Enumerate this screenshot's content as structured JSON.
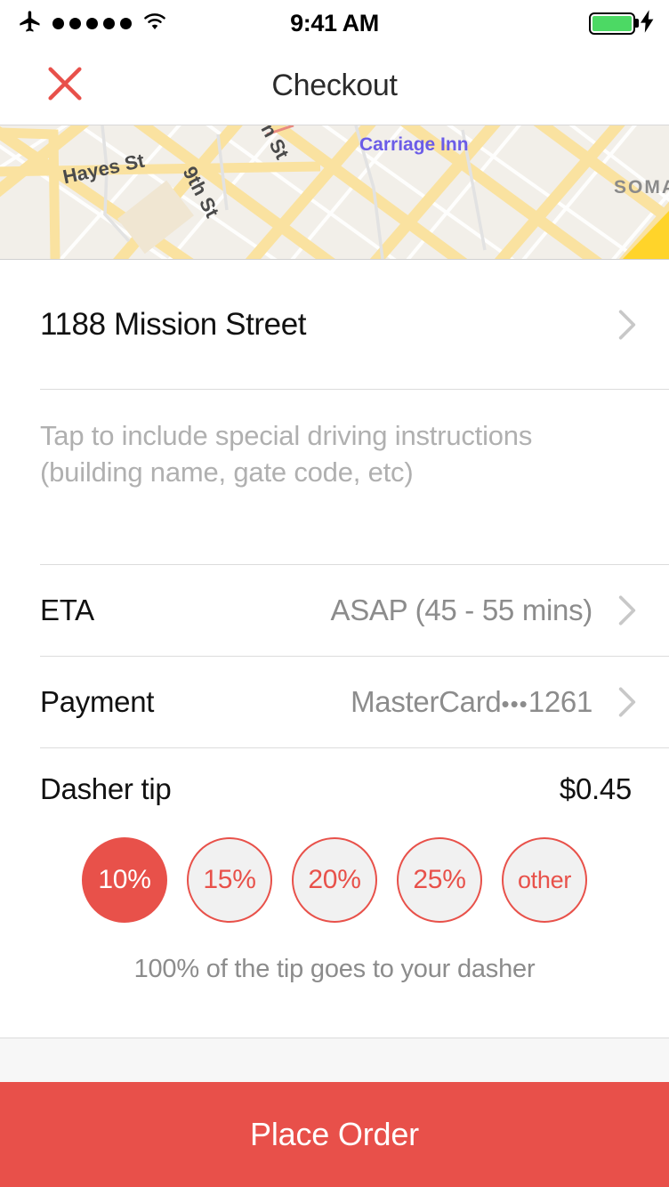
{
  "status_bar": {
    "airplane_icon": "airplane-icon",
    "signal_dots": 5,
    "wifi_icon": "wifi-icon",
    "time": "9:41 AM",
    "battery_icon": "battery-full-icon",
    "battery_color": "#4CD964",
    "charging_icon": "lightning-bolt-icon"
  },
  "navbar": {
    "close_icon": "close-icon",
    "title": "Checkout"
  },
  "map": {
    "labels": {
      "hayes": "Hayes St",
      "ninth": "9th St",
      "n_street": "n St",
      "carriage_inn": "Carriage Inn",
      "soma": "SOMA"
    },
    "colors": {
      "land": "#F2EFE9",
      "road": "#FBE08A",
      "minor_road": "#FFFFFF",
      "poi_text": "#6B5CE7",
      "highway": "#FFD42A"
    }
  },
  "delivery": {
    "address": "1188 Mission Street",
    "address_chevron": "chevron-right-icon",
    "instructions_placeholder": "Tap to include special driving instructions (building name, gate code, etc)",
    "instructions_value": ""
  },
  "rows": [
    {
      "label": "ETA",
      "value": "ASAP (45 - 55 mins)",
      "chevron": "chevron-right-icon"
    },
    {
      "label": "Payment",
      "value_prefix": "MasterCard",
      "value_dots": "•••",
      "value_suffix": "1261",
      "chevron": "chevron-right-icon"
    }
  ],
  "tip": {
    "label": "Dasher tip",
    "amount": "$0.45",
    "options": [
      {
        "label": "10%",
        "selected": true
      },
      {
        "label": "15%",
        "selected": false
      },
      {
        "label": "20%",
        "selected": false
      },
      {
        "label": "25%",
        "selected": false
      },
      {
        "label": "other",
        "selected": false
      }
    ],
    "note": "100% of the tip goes to your dasher"
  },
  "footer": {
    "place_order_label": "Place Order",
    "accent_color": "#E8504A"
  }
}
